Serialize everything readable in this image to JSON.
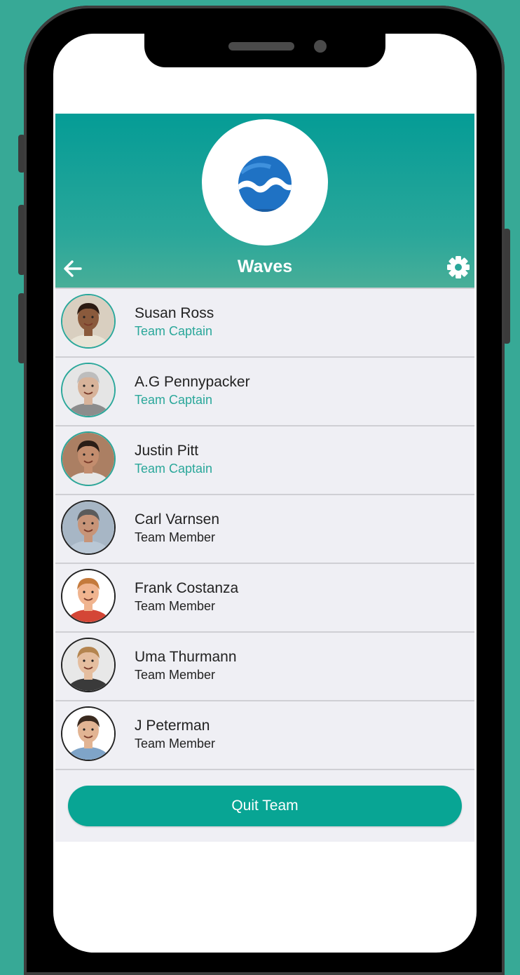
{
  "team": {
    "name": "Waves",
    "logo_icon": "wave-logo-icon"
  },
  "header": {
    "back_icon": "arrow-left-icon",
    "settings_icon": "gear-icon",
    "color": "#059c96"
  },
  "members": [
    {
      "name": "Susan Ross",
      "role": "Team Captain",
      "type": "captain",
      "skin": "#8a5a3c",
      "hair": "#2b1a12",
      "shirt": "#e9e4d6",
      "bg": "#d9cfc0"
    },
    {
      "name": "A.G Pennypacker",
      "role": "Team Captain",
      "type": "captain",
      "skin": "#d7b39a",
      "hair": "#bdbdbd",
      "shirt": "#8c8c8c",
      "bg": "#e5e5e5"
    },
    {
      "name": "Justin Pitt",
      "role": "Team Captain",
      "type": "captain",
      "skin": "#c38d6e",
      "hair": "#2a1d16",
      "shirt": "#e7e7e7",
      "bg": "#ab7f63"
    },
    {
      "name": "Carl Varnsen",
      "role": "Team Member",
      "type": "member",
      "skin": "#c79478",
      "hair": "#5b5b5b",
      "shirt": "#b9c7d5",
      "bg": "#a7b6c5"
    },
    {
      "name": "Frank Costanza",
      "role": "Team Member",
      "type": "member",
      "skin": "#f0b48f",
      "hair": "#c47a3c",
      "shirt": "#d44636",
      "bg": "#ffffff"
    },
    {
      "name": "Uma Thurmann",
      "role": "Team Member",
      "type": "member",
      "skin": "#e5be9f",
      "hair": "#b4854f",
      "shirt": "#3a3a3a",
      "bg": "#e8e8e8"
    },
    {
      "name": "J Peterman",
      "role": "Team Member",
      "type": "member",
      "skin": "#e2b493",
      "hair": "#3a2a1f",
      "shirt": "#7fa4c8",
      "bg": "#ffffff"
    }
  ],
  "actions": {
    "quit_label": "Quit Team"
  },
  "colors": {
    "background": "#37a996",
    "accent": "#2aa79a",
    "button": "#08a594"
  }
}
